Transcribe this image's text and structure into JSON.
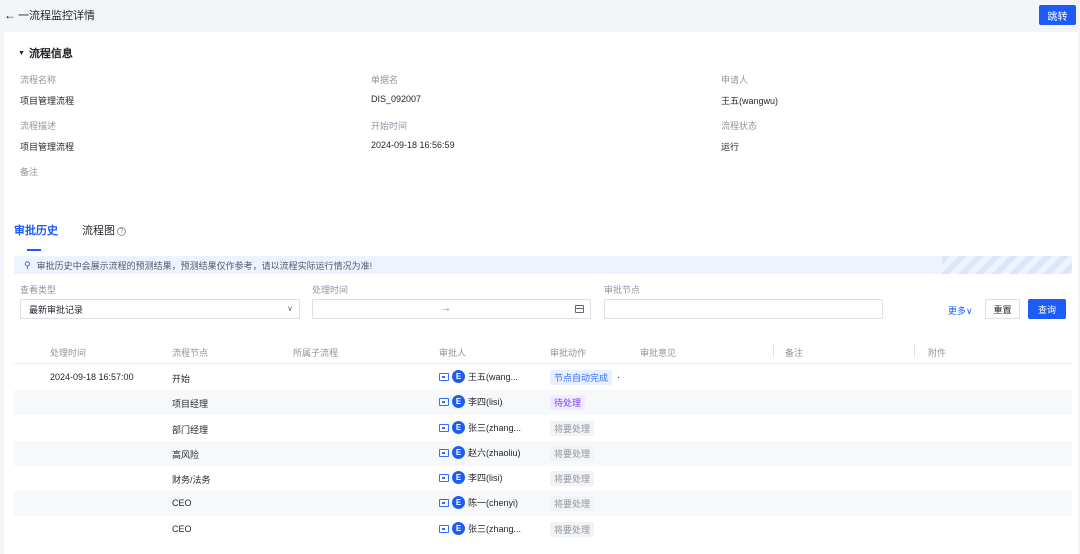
{
  "header": {
    "back_arrow": "←",
    "title": "一流程监控详情",
    "jump_button": "跳转"
  },
  "info": {
    "section_title": "流程信息",
    "fields": {
      "process_name_label": "流程名称",
      "process_name_value": "项目管理流程",
      "doc_name_label": "单据名",
      "doc_name_value": "DIS_092007",
      "applicant_label": "申请人",
      "applicant_value": "王五(wangwu)",
      "process_desc_label": "流程描述",
      "process_desc_value": "项目管理流程",
      "start_time_label": "开始时间",
      "start_time_value": "2024-09-18 16:56:59",
      "process_status_label": "流程状态",
      "process_status_value": "运行",
      "remark_label": "备注"
    }
  },
  "tabs": {
    "history": "审批历史",
    "diagram": "流程图",
    "help_glyph": "?"
  },
  "notice": {
    "text": "审批历史中会展示流程的预测结果，预测结果仅作参考，请以流程实际运行情况为准!"
  },
  "filters": {
    "view_type_label": "查看类型",
    "view_type_value": "最新审批记录",
    "time_label": "处理时间",
    "time_arrow": "→",
    "node_label": "审批节点",
    "more": "更多",
    "more_chevron": "∨",
    "reset": "重置",
    "query": "查询"
  },
  "table": {
    "headers": {
      "time": "处理时间",
      "node": "流程节点",
      "subflow": "所属子流程",
      "approver": "审批人",
      "action": "审批动作",
      "opinion": "审批意见",
      "remark": "备注",
      "attachment": "附件"
    },
    "rows": [
      {
        "time": "2024-09-18 16:57:00",
        "node": "开始",
        "avatar": "E",
        "approver": "王五(wang...",
        "status": "节点自动完成",
        "status_type": "auto",
        "opinion": "."
      },
      {
        "time": "",
        "node": "项目经理",
        "avatar": "E",
        "approver": "李四(lisi)",
        "status": "待处理",
        "status_type": "wait",
        "opinion": ""
      },
      {
        "time": "",
        "node": "部门经理",
        "avatar": "E",
        "approver": "张三(zhang...",
        "status": "将要处理",
        "status_type": "todo",
        "opinion": ""
      },
      {
        "time": "",
        "node": "高风险",
        "avatar": "E",
        "approver": "赵六(zhaoliu)",
        "status": "将要处理",
        "status_type": "todo",
        "opinion": ""
      },
      {
        "time": "",
        "node": "财务/法务",
        "avatar": "E",
        "approver": "李四(lisi)",
        "status": "将要处理",
        "status_type": "todo",
        "opinion": ""
      },
      {
        "time": "",
        "node": "CEO",
        "avatar": "E",
        "approver": "陈一(chenyi)",
        "status": "将要处理",
        "status_type": "todo",
        "opinion": ""
      },
      {
        "time": "",
        "node": "CEO",
        "avatar": "E",
        "approver": "张三(zhang...",
        "status": "将要处理",
        "status_type": "todo",
        "opinion": ""
      }
    ]
  },
  "colors": {
    "primary": "#1e5cf8",
    "auto_status": "#3370ff",
    "wait_status": "#7b3ff2",
    "todo_status": "#8f959e"
  }
}
